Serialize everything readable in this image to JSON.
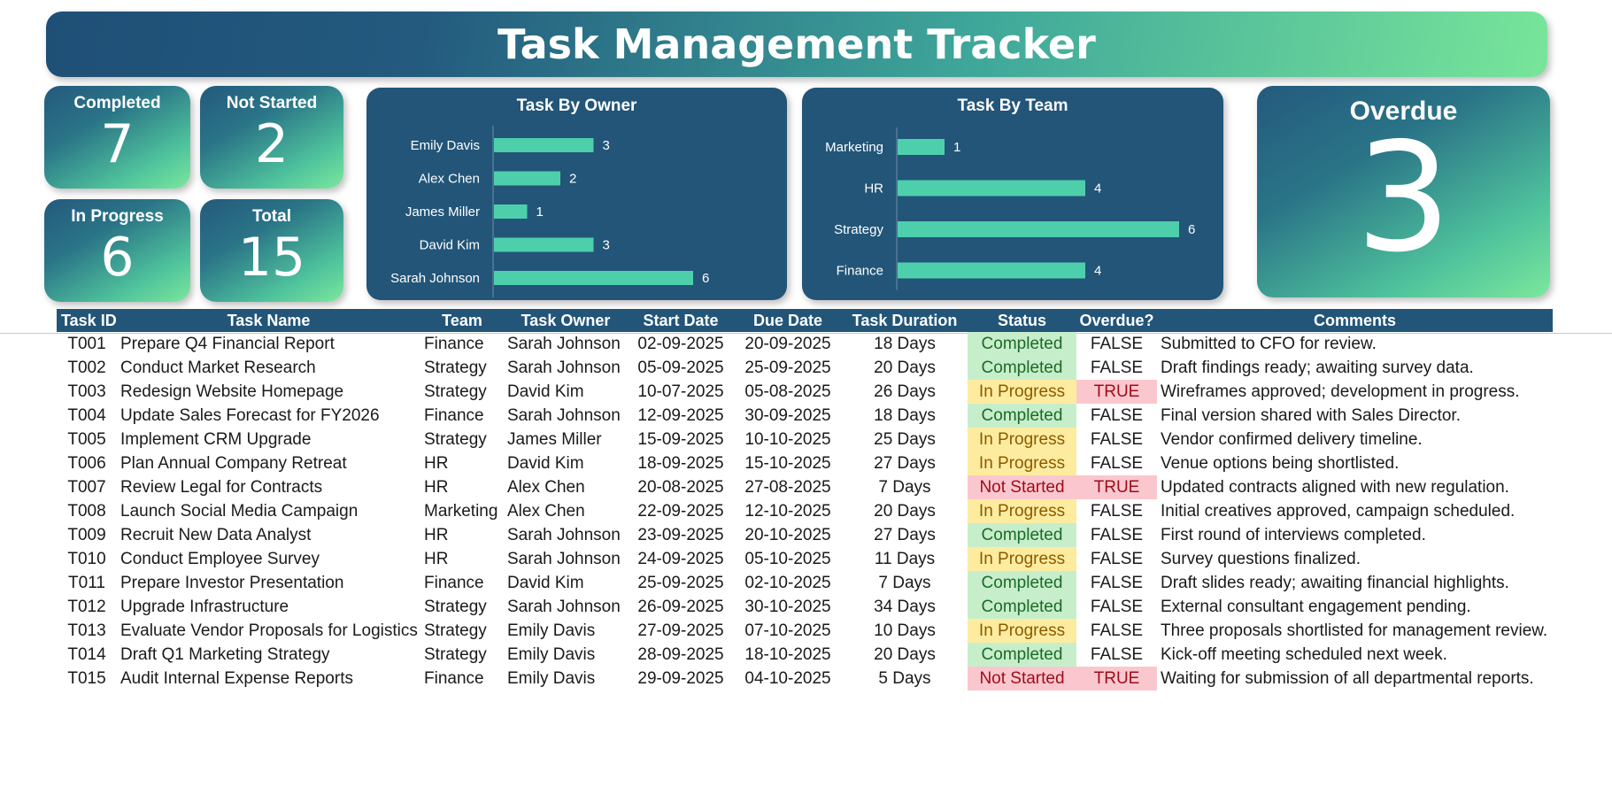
{
  "title": "Task Management Tracker",
  "kpis": {
    "completed": {
      "label": "Completed",
      "value": "7"
    },
    "not_started": {
      "label": "Not Started",
      "value": "2"
    },
    "in_progress": {
      "label": "In Progress",
      "value": "6"
    },
    "total": {
      "label": "Total",
      "value": "15"
    },
    "overdue": {
      "label": "Overdue",
      "value": "3"
    }
  },
  "colors": {
    "accent": "#225578",
    "bar": "#4ecfab",
    "completed": "#c7eecb",
    "in_progress": "#fdeca0",
    "not_started": "#fbc7ce"
  },
  "chart_data": [
    {
      "type": "bar",
      "orientation": "horizontal",
      "title": "Task By Owner",
      "categories": [
        "Emily Davis",
        "Alex Chen",
        "James Miller",
        "David Kim",
        "Sarah Johnson"
      ],
      "values": [
        3,
        2,
        1,
        3,
        6
      ],
      "data_labels": true,
      "grid": false
    },
    {
      "type": "bar",
      "orientation": "horizontal",
      "title": "Task By Team",
      "categories": [
        "Marketing",
        "HR",
        "Strategy",
        "Finance"
      ],
      "values": [
        1,
        4,
        6,
        4
      ],
      "data_labels": true,
      "grid": false
    }
  ],
  "table": {
    "headers": {
      "task_id": "Task ID",
      "task_name": "Task Name",
      "team": "Team",
      "owner": "Task Owner",
      "start": "Start Date",
      "due": "Due Date",
      "duration": "Task Duration",
      "status": "Status",
      "overdue": "Overdue?",
      "comments": "Comments"
    },
    "rows": [
      {
        "id": "T001",
        "name": "Prepare Q4 Financial Report",
        "team": "Finance",
        "owner": "Sarah Johnson",
        "start": "02-09-2025",
        "due": "20-09-2025",
        "duration": "18 Days",
        "status": "Completed",
        "overdue": "FALSE",
        "comments": "Submitted to CFO for review."
      },
      {
        "id": "T002",
        "name": "Conduct Market Research",
        "team": "Strategy",
        "owner": "Sarah Johnson",
        "start": "05-09-2025",
        "due": "25-09-2025",
        "duration": "20 Days",
        "status": "Completed",
        "overdue": "FALSE",
        "comments": "Draft findings ready; awaiting survey data."
      },
      {
        "id": "T003",
        "name": "Redesign Website Homepage",
        "team": "Strategy",
        "owner": "David Kim",
        "start": "10-07-2025",
        "due": "05-08-2025",
        "duration": "26 Days",
        "status": "In Progress",
        "overdue": "TRUE",
        "comments": "Wireframes approved; development in progress."
      },
      {
        "id": "T004",
        "name": "Update Sales Forecast for FY2026",
        "team": "Finance",
        "owner": "Sarah Johnson",
        "start": "12-09-2025",
        "due": "30-09-2025",
        "duration": "18 Days",
        "status": "Completed",
        "overdue": "FALSE",
        "comments": "Final version shared with Sales Director."
      },
      {
        "id": "T005",
        "name": "Implement CRM Upgrade",
        "team": "Strategy",
        "owner": "James Miller",
        "start": "15-09-2025",
        "due": "10-10-2025",
        "duration": "25 Days",
        "status": "In Progress",
        "overdue": "FALSE",
        "comments": "Vendor confirmed delivery timeline."
      },
      {
        "id": "T006",
        "name": "Plan Annual Company Retreat",
        "team": "HR",
        "owner": "David Kim",
        "start": "18-09-2025",
        "due": "15-10-2025",
        "duration": "27 Days",
        "status": "In Progress",
        "overdue": "FALSE",
        "comments": "Venue options being shortlisted."
      },
      {
        "id": "T007",
        "name": "Review Legal for Contracts",
        "team": "HR",
        "owner": "Alex Chen",
        "start": "20-08-2025",
        "due": "27-08-2025",
        "duration": "7 Days",
        "status": "Not Started",
        "overdue": "TRUE",
        "comments": "Updated contracts aligned with new regulation."
      },
      {
        "id": "T008",
        "name": "Launch Social Media Campaign",
        "team": "Marketing",
        "owner": "Alex Chen",
        "start": "22-09-2025",
        "due": "12-10-2025",
        "duration": "20 Days",
        "status": "In Progress",
        "overdue": "FALSE",
        "comments": "Initial creatives approved, campaign scheduled."
      },
      {
        "id": "T009",
        "name": "Recruit New Data Analyst",
        "team": "HR",
        "owner": "Sarah Johnson",
        "start": "23-09-2025",
        "due": "20-10-2025",
        "duration": "27 Days",
        "status": "Completed",
        "overdue": "FALSE",
        "comments": "First round of interviews completed."
      },
      {
        "id": "T010",
        "name": "Conduct Employee Survey",
        "team": "HR",
        "owner": "Sarah Johnson",
        "start": "24-09-2025",
        "due": "05-10-2025",
        "duration": "11 Days",
        "status": "In Progress",
        "overdue": "FALSE",
        "comments": "Survey questions finalized."
      },
      {
        "id": "T011",
        "name": "Prepare Investor Presentation",
        "team": "Finance",
        "owner": "David Kim",
        "start": "25-09-2025",
        "due": "02-10-2025",
        "duration": "7 Days",
        "status": "Completed",
        "overdue": "FALSE",
        "comments": "Draft slides ready; awaiting financial highlights."
      },
      {
        "id": "T012",
        "name": "Upgrade Infrastructure",
        "team": "Strategy",
        "owner": "Sarah Johnson",
        "start": "26-09-2025",
        "due": "30-10-2025",
        "duration": "34 Days",
        "status": "Completed",
        "overdue": "FALSE",
        "comments": "External consultant engagement pending."
      },
      {
        "id": "T013",
        "name": "Evaluate Vendor Proposals for Logistics",
        "team": "Strategy",
        "owner": "Emily Davis",
        "start": "27-09-2025",
        "due": "07-10-2025",
        "duration": "10 Days",
        "status": "In Progress",
        "overdue": "FALSE",
        "comments": "Three proposals shortlisted for management review."
      },
      {
        "id": "T014",
        "name": "Draft Q1 Marketing Strategy",
        "team": "Strategy",
        "owner": "Emily Davis",
        "start": "28-09-2025",
        "due": "18-10-2025",
        "duration": "20 Days",
        "status": "Completed",
        "overdue": "FALSE",
        "comments": "Kick-off meeting scheduled next week."
      },
      {
        "id": "T015",
        "name": "Audit Internal Expense Reports",
        "team": "Finance",
        "owner": "Emily Davis",
        "start": "29-09-2025",
        "due": "04-10-2025",
        "duration": "5 Days",
        "status": "Not Started",
        "overdue": "TRUE",
        "comments": "Waiting for submission of all departmental reports."
      }
    ]
  }
}
